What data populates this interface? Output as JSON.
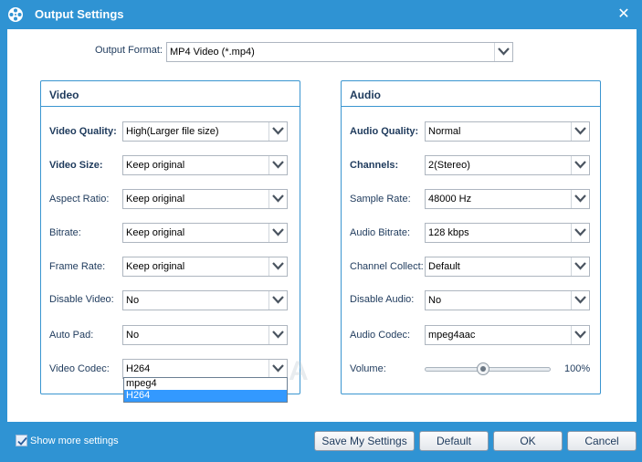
{
  "window": {
    "title": "Output Settings",
    "app_icon": "film-reel-icon",
    "close_glyph": "✕"
  },
  "output_format": {
    "label": "Output Format:",
    "value": "MP4 Video (*.mp4)"
  },
  "video": {
    "title": "Video",
    "quality": {
      "label": "Video Quality:",
      "value": "High(Larger file size)"
    },
    "size": {
      "label": "Video Size:",
      "value": "Keep original"
    },
    "aspect_ratio": {
      "label": "Aspect Ratio:",
      "value": "Keep original"
    },
    "bitrate": {
      "label": "Bitrate:",
      "value": "Keep original"
    },
    "frame_rate": {
      "label": "Frame Rate:",
      "value": "Keep original"
    },
    "disable_video": {
      "label": "Disable Video:",
      "value": "No"
    },
    "auto_pad": {
      "label": "Auto Pad:",
      "value": "No"
    },
    "codec": {
      "label": "Video Codec:",
      "value": "H264",
      "options": [
        "mpeg4",
        "H264"
      ],
      "selected_option": "H264"
    }
  },
  "audio": {
    "title": "Audio",
    "quality": {
      "label": "Audio Quality:",
      "value": "Normal"
    },
    "channels": {
      "label": "Channels:",
      "value": "2(Stereo)"
    },
    "sample_rate": {
      "label": "Sample Rate:",
      "value": "48000 Hz"
    },
    "bitrate": {
      "label": "Audio Bitrate:",
      "value": "128 kbps"
    },
    "channel_collect": {
      "label": "Channel Collect:",
      "value": "Default"
    },
    "disable_audio": {
      "label": "Disable Audio:",
      "value": "No"
    },
    "codec": {
      "label": "Audio Codec:",
      "value": "mpeg4aac"
    },
    "volume": {
      "label": "Volume:",
      "value": "100%",
      "level": 0.46
    }
  },
  "footer": {
    "show_more": {
      "label": "Show more settings",
      "checked": true
    },
    "save_settings": "Save My Settings",
    "default": "Default",
    "ok": "OK",
    "cancel": "Cancel"
  },
  "watermark": "SOFTPEDIA",
  "colors": {
    "frame": "#2f93d3",
    "group_border": "#3a95d0",
    "label_text": "#1e3a5c",
    "selection": "#3399ff"
  }
}
